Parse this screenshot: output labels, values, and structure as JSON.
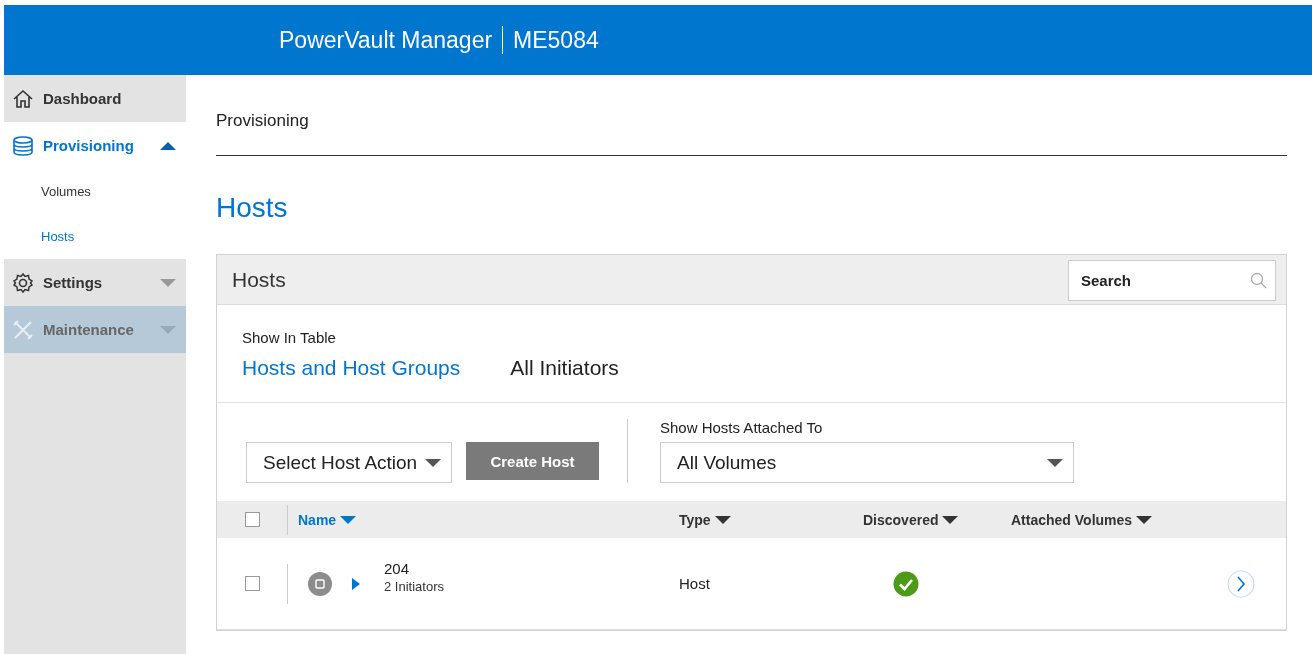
{
  "header": {
    "product": "PowerVault Manager",
    "model": "ME5084"
  },
  "sidebar": {
    "items": [
      {
        "label": "Dashboard",
        "selected": false,
        "disabled": false
      },
      {
        "label": "Provisioning",
        "selected": true,
        "expanded": true,
        "disabled": false,
        "children": [
          {
            "label": "Volumes",
            "selected": false
          },
          {
            "label": "Hosts",
            "selected": true
          }
        ]
      },
      {
        "label": "Settings",
        "selected": false,
        "expanded": false,
        "disabled": false
      },
      {
        "label": "Maintenance",
        "selected": false,
        "expanded": false,
        "disabled": true
      }
    ]
  },
  "breadcrumb": "Provisioning",
  "page_title": "Hosts",
  "panel": {
    "title": "Hosts",
    "search": {
      "placeholder": "Search"
    },
    "show_in_table": {
      "label": "Show In Table",
      "tabs": [
        {
          "label": "Hosts and Host Groups",
          "selected": true
        },
        {
          "label": "All Initiators",
          "selected": false
        }
      ]
    },
    "host_action": {
      "value": "Select Host Action"
    },
    "create_button": "Create Host",
    "attached_to": {
      "label": "Show Hosts Attached To",
      "value": "All Volumes"
    },
    "table": {
      "select_all": {
        "checked": false
      },
      "columns": [
        {
          "label": "Name",
          "selected": true
        },
        {
          "label": "Type",
          "selected": false
        },
        {
          "label": "Discovered",
          "selected": false
        },
        {
          "label": "Attached Volumes",
          "selected": false
        }
      ],
      "rows": [
        {
          "checked": false,
          "expanded": false,
          "name": "204",
          "initiators": "2 Initiators",
          "type": "Host",
          "discovered": true
        }
      ]
    }
  }
}
